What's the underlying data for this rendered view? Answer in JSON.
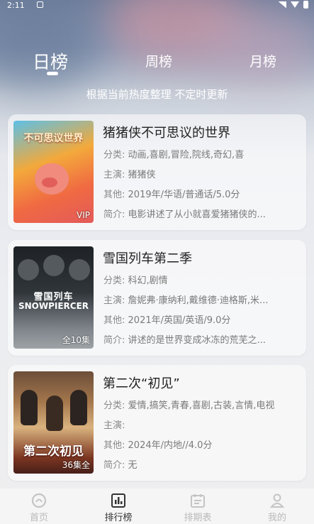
{
  "status_bar": {
    "time": "2:11"
  },
  "tabs": [
    {
      "label": "日榜",
      "active": true
    },
    {
      "label": "周榜",
      "active": false
    },
    {
      "label": "月榜",
      "active": false
    }
  ],
  "subtitle": "根据当前热度整理 不定时更新",
  "labels": {
    "category": "分类:",
    "cast": "主演:",
    "other": "其他:",
    "intro": "简介:"
  },
  "items": [
    {
      "title": "猪猪侠不可思议的世界",
      "poster_art_text": "不可思议世界",
      "poster_badge": "VIP",
      "category": "动画,喜剧,冒险,院线,奇幻,喜",
      "cast": "猪猪侠",
      "other": "2019年/华语/普通话/5.0分",
      "intro": "电影讲述了从小就喜爱猪猪侠的..."
    },
    {
      "title": "雪国列车第二季",
      "poster_art_text": "雪国列车",
      "poster_art_subtext": "SNOWPIERCER",
      "poster_badge": "全10集",
      "category": "科幻,剧情",
      "cast": "詹妮弗·康纳利,戴维德·迪格斯,米...",
      "other": "2021年/英国/英语/9.0分",
      "intro": "讲述的是世界变成冰冻的荒芜之..."
    },
    {
      "title": "第二次“初见”",
      "poster_art_text": "第二次初见",
      "poster_badge": "36集全",
      "category": "爱情,搞笑,青春,喜剧,古装,言情,电视",
      "cast": "",
      "other": "2024年/内地//4.0分",
      "intro": "无"
    }
  ],
  "bottom_nav": [
    {
      "label": "首页",
      "icon": "home-icon",
      "active": false
    },
    {
      "label": "排行榜",
      "icon": "ranking-icon",
      "active": true
    },
    {
      "label": "排期表",
      "icon": "calendar-icon",
      "active": false
    },
    {
      "label": "我的",
      "icon": "profile-icon",
      "active": false
    }
  ]
}
